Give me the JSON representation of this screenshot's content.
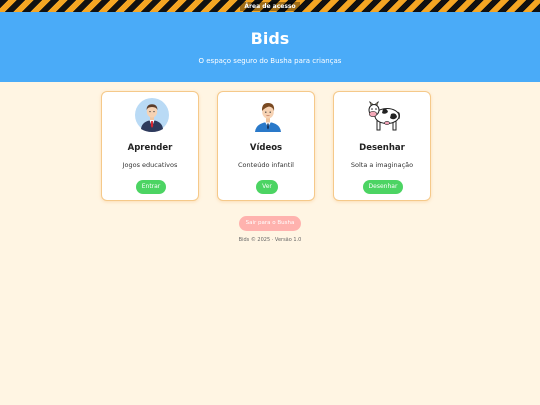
{
  "warning_bar": {
    "text": "Área de acesso"
  },
  "header": {
    "title": "Bids",
    "subtitle": "O espaço seguro do Busha para crianças"
  },
  "cards": [
    {
      "title": "Aprender",
      "description": "Jogos educativos",
      "button": "Entrar",
      "icon": "teacher-avatar-icon"
    },
    {
      "title": "Vídeos",
      "description": "Conteúdo infantil",
      "button": "Ver",
      "icon": "boy-avatar-icon"
    },
    {
      "title": "Desenhar",
      "description": "Solta a imaginação",
      "button": "Desenhar",
      "icon": "cow-icon"
    }
  ],
  "exit_button": {
    "label": "Sair para o Busha"
  },
  "footer": {
    "text": "Bids © 2025 · Versão 1.0"
  },
  "colors": {
    "background": "#fff5e3",
    "header": "#4aabf8",
    "card_border": "#f5c98a",
    "action_button": "#4cd463",
    "exit_button": "#ffb2ae"
  }
}
